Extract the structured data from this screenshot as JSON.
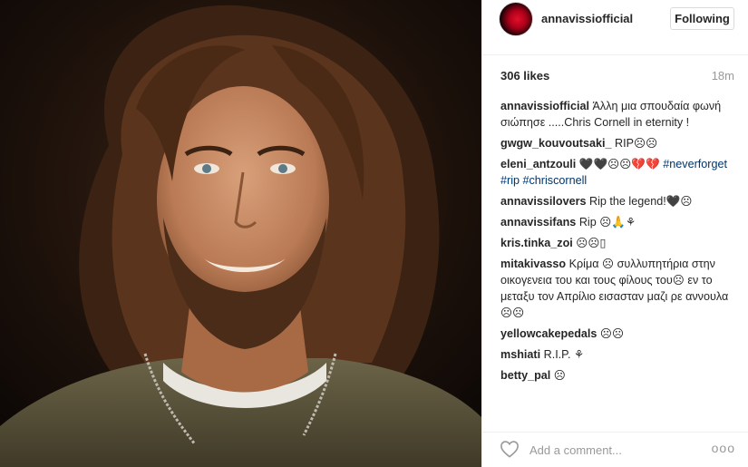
{
  "post": {
    "username": "annavissiofficial",
    "follow_label": "Following",
    "likes": "306 likes",
    "time": "18m"
  },
  "comments": [
    {
      "user": "annavissiofficial",
      "text": "Άλλη μια σπουδαία φωνή σιώπησε .....Chris Cornell in eternity !"
    },
    {
      "user": "gwgw_kouvoutsaki_",
      "text": "RIP☹☹"
    },
    {
      "user": "eleni_antzouli",
      "text": "🖤🖤☹☹💔💔",
      "tags": "#neverforget #rip #chriscornell"
    },
    {
      "user": "annavissilovers",
      "text": "Rip the legend!🖤☹"
    },
    {
      "user": "annavissifans",
      "text": "Rip ☹🙏⚘"
    },
    {
      "user": "kris.tinka_zoi",
      "text": "☹☹▯"
    },
    {
      "user": "mitakivasso",
      "text": "Κρίμα ☹ συλλυπητήρια στην οικογενεια του και τους φίλους του☹ εν το μεταξυ τον Απρίλιο εισασταν μαζι ρε αννουλα☹☹"
    },
    {
      "user": "yellowcakepedals",
      "text": "☹☹"
    },
    {
      "user": "mshiati",
      "text": "R.I.P. ⚘"
    },
    {
      "user": "betty_pal",
      "text": "☹"
    }
  ],
  "footer": {
    "comment_placeholder": "Add a comment...",
    "more_label": "ooo"
  },
  "icons": {
    "like": "heart-outline-icon",
    "more": "more-options-icon"
  }
}
